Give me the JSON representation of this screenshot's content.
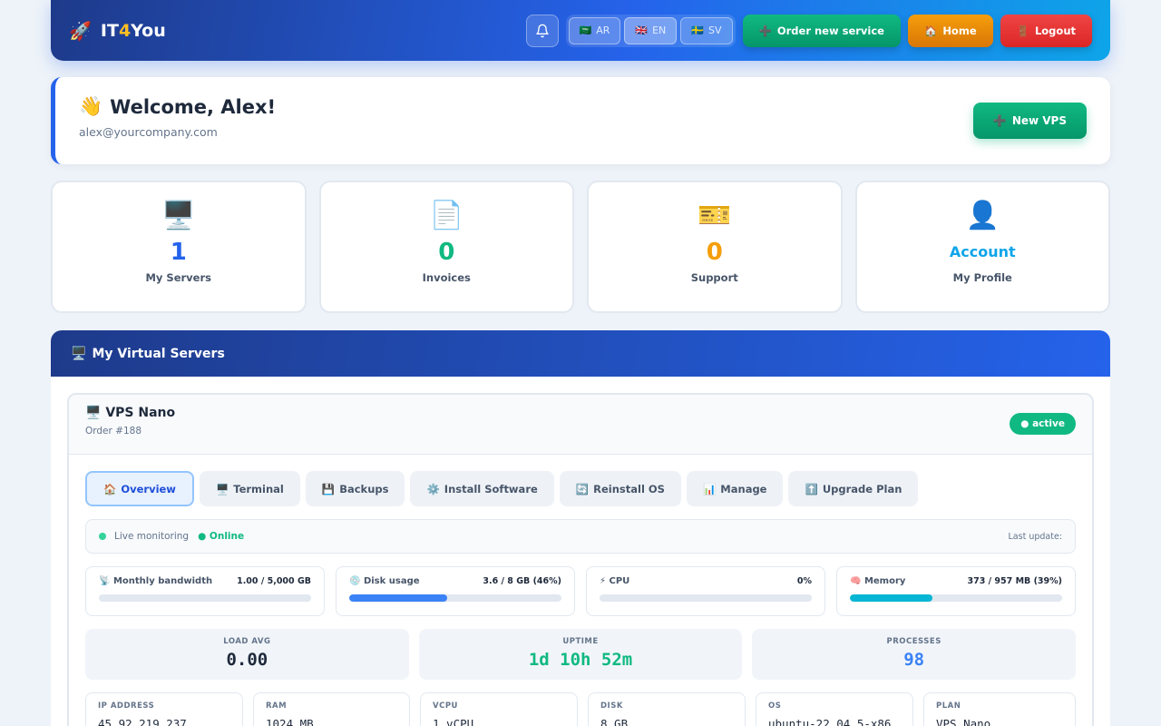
{
  "header": {
    "brand_prefix": "IT",
    "brand_four": "4",
    "brand_suffix": "You",
    "languages": [
      {
        "flag": "🇸🇦",
        "code": "AR"
      },
      {
        "flag": "🇬🇧",
        "code": "EN"
      },
      {
        "flag": "🇸🇪",
        "code": "SV"
      }
    ],
    "active_language": "EN",
    "order_label": "Order new service",
    "home_label": "Home",
    "logout_label": "Logout"
  },
  "welcome": {
    "greeting": "Welcome, Alex!",
    "email": "alex@yourcompany.com",
    "new_vps_label": "New VPS"
  },
  "stats": [
    {
      "icon": "🖥️",
      "value": "1",
      "label": "My Servers",
      "color": "#2563eb"
    },
    {
      "icon": "📄",
      "value": "0",
      "label": "Invoices",
      "color": "#10b981"
    },
    {
      "icon": "🎫",
      "value": "0",
      "label": "Support",
      "color": "#f59e0b"
    },
    {
      "icon": "👤",
      "value": "Account",
      "label": "My Profile",
      "color": "#0ea5e9"
    }
  ],
  "servers": {
    "section_title": "My Virtual Servers",
    "vps_name": "VPS Nano",
    "order": "Order #188",
    "status": "● active",
    "tabs": [
      "Overview",
      "Terminal",
      "Backups",
      "Install Software",
      "Reinstall OS",
      "Manage",
      "Upgrade Plan"
    ],
    "tab_icons": [
      "🏠",
      "🖥️",
      "💾",
      "⚙️",
      "🔄",
      "📊",
      "⬆️"
    ],
    "active_tab": "Overview",
    "live_label": "Live monitoring",
    "online_label": "● Online",
    "last_update_label": "Last update:",
    "meters": [
      {
        "icon": "📡",
        "name": "Monthly bandwidth",
        "amount": "1.00 / 5,000 GB",
        "percent": 0.02,
        "color": "#3b82f6"
      },
      {
        "icon": "💿",
        "name": "Disk usage",
        "amount": "3.6 / 8 GB (46%)",
        "percent": 46,
        "color": "#3b82f6"
      },
      {
        "icon": "⚡",
        "name": "CPU",
        "amount": "0%",
        "percent": 0,
        "color": "#3b82f6"
      },
      {
        "icon": "🧠",
        "name": "Memory",
        "amount": "373 / 957 MB (39%)",
        "percent": 39,
        "color": "#06b6d4"
      }
    ],
    "big_stats": [
      {
        "caption": "LOAD AVG",
        "value": "0.00",
        "color": "#1e293b"
      },
      {
        "caption": "UPTIME",
        "value": "1d 10h 52m",
        "color": "#10b981"
      },
      {
        "caption": "PROCESSES",
        "value": "98",
        "color": "#3b82f6"
      }
    ],
    "infos": [
      {
        "caption": "IP ADDRESS",
        "value": "45.92.219.237"
      },
      {
        "caption": "RAM",
        "value": "1024 MB"
      },
      {
        "caption": "VCPU",
        "value": "1 vCPU"
      },
      {
        "caption": "DISK",
        "value": "8 GB"
      },
      {
        "caption": "OS",
        "value": "ubuntu-22.04.5-x86"
      },
      {
        "caption": "PLAN",
        "value": "VPS Nano"
      }
    ]
  }
}
